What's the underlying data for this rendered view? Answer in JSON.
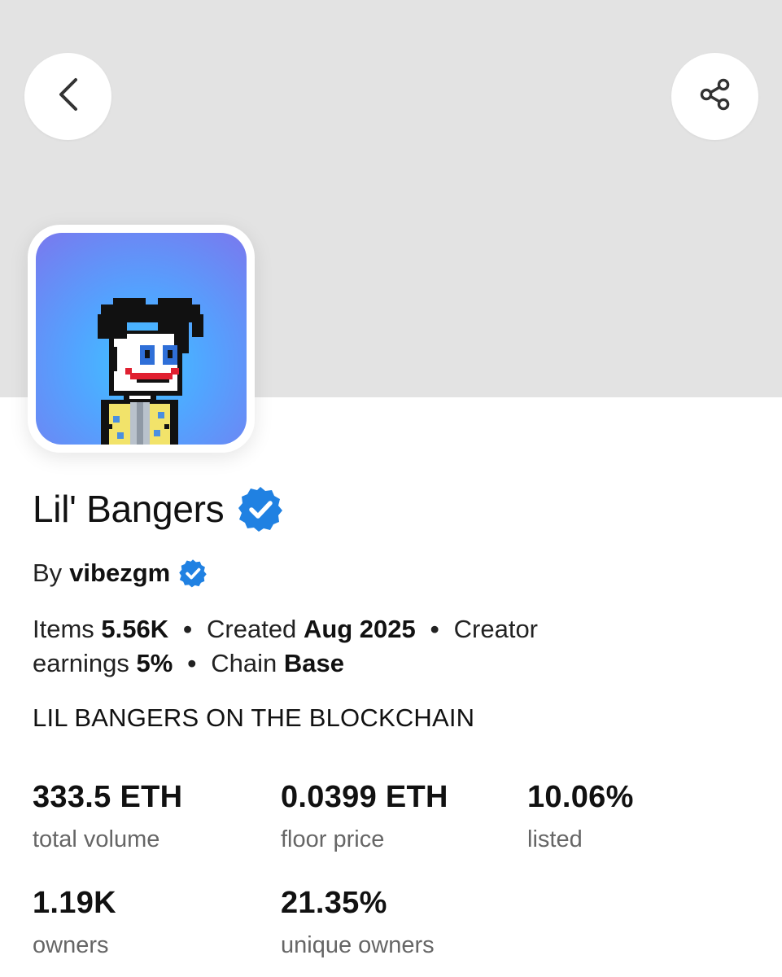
{
  "header": {
    "back_icon": "chevron-left-icon",
    "share_icon": "share-icon"
  },
  "collection": {
    "name": "Lil' Bangers",
    "verified": true,
    "by_label": "By",
    "creator": "vibezgm",
    "creator_verified": true,
    "verified_color": "#2081e2",
    "items_label": "Items",
    "items_value": "5.56K",
    "created_label": "Created",
    "created_value": "Aug 2025",
    "earnings_label_1": "Creator",
    "earnings_label_2": "earnings",
    "earnings_value": "5%",
    "chain_label": "Chain",
    "chain_value": "Base",
    "separator": "•",
    "description": "LIL BANGERS ON THE BLOCKCHAIN"
  },
  "stats": [
    {
      "value": "333.5 ETH",
      "label": "total volume"
    },
    {
      "value": "0.0399 ETH",
      "label": "floor price"
    },
    {
      "value": "10.06%",
      "label": "listed"
    },
    {
      "value": "1.19K",
      "label": "owners"
    },
    {
      "value": "21.35%",
      "label": "unique owners"
    }
  ]
}
